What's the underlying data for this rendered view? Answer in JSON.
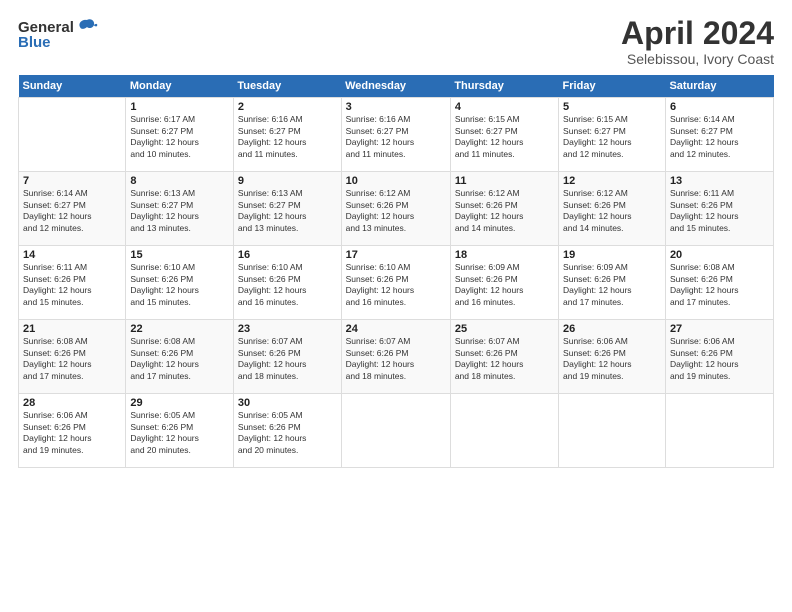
{
  "header": {
    "logo_general": "General",
    "logo_blue": "Blue",
    "title": "April 2024",
    "subtitle": "Selebissou, Ivory Coast"
  },
  "days_of_week": [
    "Sunday",
    "Monday",
    "Tuesday",
    "Wednesday",
    "Thursday",
    "Friday",
    "Saturday"
  ],
  "weeks": [
    [
      {
        "num": "",
        "info": ""
      },
      {
        "num": "1",
        "info": "Sunrise: 6:17 AM\nSunset: 6:27 PM\nDaylight: 12 hours\nand 10 minutes."
      },
      {
        "num": "2",
        "info": "Sunrise: 6:16 AM\nSunset: 6:27 PM\nDaylight: 12 hours\nand 11 minutes."
      },
      {
        "num": "3",
        "info": "Sunrise: 6:16 AM\nSunset: 6:27 PM\nDaylight: 12 hours\nand 11 minutes."
      },
      {
        "num": "4",
        "info": "Sunrise: 6:15 AM\nSunset: 6:27 PM\nDaylight: 12 hours\nand 11 minutes."
      },
      {
        "num": "5",
        "info": "Sunrise: 6:15 AM\nSunset: 6:27 PM\nDaylight: 12 hours\nand 12 minutes."
      },
      {
        "num": "6",
        "info": "Sunrise: 6:14 AM\nSunset: 6:27 PM\nDaylight: 12 hours\nand 12 minutes."
      }
    ],
    [
      {
        "num": "7",
        "info": "Sunrise: 6:14 AM\nSunset: 6:27 PM\nDaylight: 12 hours\nand 12 minutes."
      },
      {
        "num": "8",
        "info": "Sunrise: 6:13 AM\nSunset: 6:27 PM\nDaylight: 12 hours\nand 13 minutes."
      },
      {
        "num": "9",
        "info": "Sunrise: 6:13 AM\nSunset: 6:27 PM\nDaylight: 12 hours\nand 13 minutes."
      },
      {
        "num": "10",
        "info": "Sunrise: 6:12 AM\nSunset: 6:26 PM\nDaylight: 12 hours\nand 13 minutes."
      },
      {
        "num": "11",
        "info": "Sunrise: 6:12 AM\nSunset: 6:26 PM\nDaylight: 12 hours\nand 14 minutes."
      },
      {
        "num": "12",
        "info": "Sunrise: 6:12 AM\nSunset: 6:26 PM\nDaylight: 12 hours\nand 14 minutes."
      },
      {
        "num": "13",
        "info": "Sunrise: 6:11 AM\nSunset: 6:26 PM\nDaylight: 12 hours\nand 15 minutes."
      }
    ],
    [
      {
        "num": "14",
        "info": "Sunrise: 6:11 AM\nSunset: 6:26 PM\nDaylight: 12 hours\nand 15 minutes."
      },
      {
        "num": "15",
        "info": "Sunrise: 6:10 AM\nSunset: 6:26 PM\nDaylight: 12 hours\nand 15 minutes."
      },
      {
        "num": "16",
        "info": "Sunrise: 6:10 AM\nSunset: 6:26 PM\nDaylight: 12 hours\nand 16 minutes."
      },
      {
        "num": "17",
        "info": "Sunrise: 6:10 AM\nSunset: 6:26 PM\nDaylight: 12 hours\nand 16 minutes."
      },
      {
        "num": "18",
        "info": "Sunrise: 6:09 AM\nSunset: 6:26 PM\nDaylight: 12 hours\nand 16 minutes."
      },
      {
        "num": "19",
        "info": "Sunrise: 6:09 AM\nSunset: 6:26 PM\nDaylight: 12 hours\nand 17 minutes."
      },
      {
        "num": "20",
        "info": "Sunrise: 6:08 AM\nSunset: 6:26 PM\nDaylight: 12 hours\nand 17 minutes."
      }
    ],
    [
      {
        "num": "21",
        "info": "Sunrise: 6:08 AM\nSunset: 6:26 PM\nDaylight: 12 hours\nand 17 minutes."
      },
      {
        "num": "22",
        "info": "Sunrise: 6:08 AM\nSunset: 6:26 PM\nDaylight: 12 hours\nand 17 minutes."
      },
      {
        "num": "23",
        "info": "Sunrise: 6:07 AM\nSunset: 6:26 PM\nDaylight: 12 hours\nand 18 minutes."
      },
      {
        "num": "24",
        "info": "Sunrise: 6:07 AM\nSunset: 6:26 PM\nDaylight: 12 hours\nand 18 minutes."
      },
      {
        "num": "25",
        "info": "Sunrise: 6:07 AM\nSunset: 6:26 PM\nDaylight: 12 hours\nand 18 minutes."
      },
      {
        "num": "26",
        "info": "Sunrise: 6:06 AM\nSunset: 6:26 PM\nDaylight: 12 hours\nand 19 minutes."
      },
      {
        "num": "27",
        "info": "Sunrise: 6:06 AM\nSunset: 6:26 PM\nDaylight: 12 hours\nand 19 minutes."
      }
    ],
    [
      {
        "num": "28",
        "info": "Sunrise: 6:06 AM\nSunset: 6:26 PM\nDaylight: 12 hours\nand 19 minutes."
      },
      {
        "num": "29",
        "info": "Sunrise: 6:05 AM\nSunset: 6:26 PM\nDaylight: 12 hours\nand 20 minutes."
      },
      {
        "num": "30",
        "info": "Sunrise: 6:05 AM\nSunset: 6:26 PM\nDaylight: 12 hours\nand 20 minutes."
      },
      {
        "num": "",
        "info": ""
      },
      {
        "num": "",
        "info": ""
      },
      {
        "num": "",
        "info": ""
      },
      {
        "num": "",
        "info": ""
      }
    ]
  ]
}
